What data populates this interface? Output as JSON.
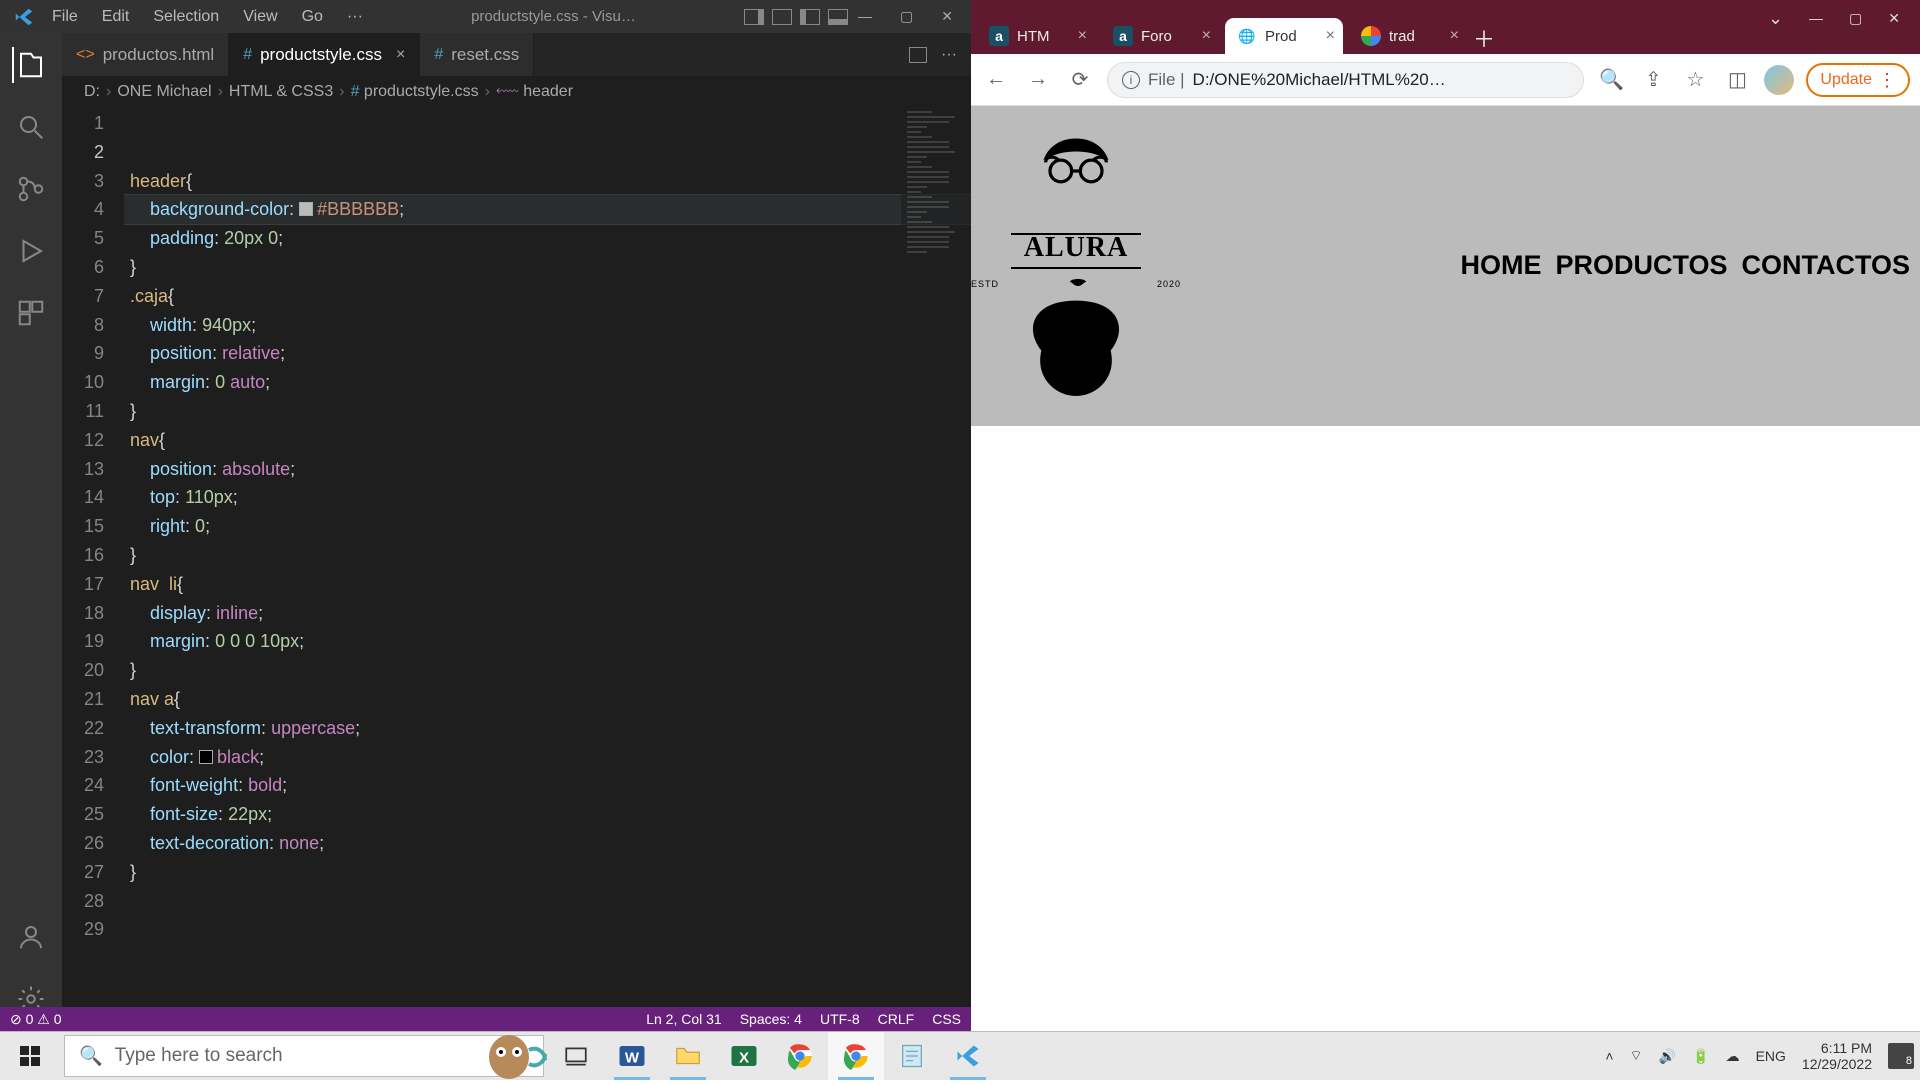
{
  "vscode": {
    "menu": [
      "File",
      "Edit",
      "Selection",
      "View",
      "Go",
      "···"
    ],
    "title": "productstyle.css - Visu…",
    "tabs": [
      {
        "icon": "<>",
        "name": "productos.html",
        "color": "#e37933",
        "active": false,
        "close": false
      },
      {
        "icon": "#",
        "name": "productstyle.css",
        "color": "#519aba",
        "active": true,
        "close": true
      },
      {
        "icon": "#",
        "name": "reset.css",
        "color": "#519aba",
        "active": false,
        "close": false
      }
    ],
    "breadcrumb": [
      "D:",
      "ONE Michael",
      "HTML & CSS3",
      "productstyle.css",
      "header"
    ],
    "statusbar": {
      "left": [
        "⊘ 0",
        "⚠ 0"
      ],
      "right": [
        "Ln 2, Col 31",
        "Spaces: 4",
        "UTF-8",
        "CRLF",
        "CSS"
      ]
    },
    "code": [
      [
        [
          "sel",
          "header"
        ],
        [
          "punc",
          "{"
        ]
      ],
      [
        [
          "sp",
          "    "
        ],
        [
          "prop",
          "background-color"
        ],
        [
          "punc",
          ": "
        ],
        [
          "swatch",
          "#BBBBBB"
        ],
        [
          "hex",
          "#BBBBBB"
        ],
        [
          "punc",
          ";"
        ]
      ],
      [
        [
          "sp",
          "    "
        ],
        [
          "prop",
          "padding"
        ],
        [
          "punc",
          ": "
        ],
        [
          "val",
          "20px 0"
        ],
        [
          "punc",
          ";"
        ]
      ],
      [
        [
          "punc",
          "}"
        ]
      ],
      [],
      [
        [
          "sel",
          ".caja"
        ],
        [
          "punc",
          "{"
        ]
      ],
      [
        [
          "sp",
          "    "
        ],
        [
          "prop",
          "width"
        ],
        [
          "punc",
          ": "
        ],
        [
          "val",
          "940px"
        ],
        [
          "punc",
          ";"
        ]
      ],
      [
        [
          "sp",
          "    "
        ],
        [
          "prop",
          "position"
        ],
        [
          "punc",
          ": "
        ],
        [
          "kw",
          "relative"
        ],
        [
          "punc",
          ";"
        ]
      ],
      [
        [
          "sp",
          "    "
        ],
        [
          "prop",
          "margin"
        ],
        [
          "punc",
          ": "
        ],
        [
          "val",
          "0 "
        ],
        [
          "kw",
          "auto"
        ],
        [
          "punc",
          ";"
        ]
      ],
      [
        [
          "punc",
          "}"
        ]
      ],
      [],
      [
        [
          "sel",
          "nav"
        ],
        [
          "punc",
          "{"
        ]
      ],
      [
        [
          "sp",
          "    "
        ],
        [
          "prop",
          "position"
        ],
        [
          "punc",
          ": "
        ],
        [
          "kw",
          "absolute"
        ],
        [
          "punc",
          ";"
        ]
      ],
      [
        [
          "sp",
          "    "
        ],
        [
          "prop",
          "top"
        ],
        [
          "punc",
          ": "
        ],
        [
          "val",
          "110px"
        ],
        [
          "punc",
          ";"
        ]
      ],
      [
        [
          "sp",
          "    "
        ],
        [
          "prop",
          "right"
        ],
        [
          "punc",
          ": "
        ],
        [
          "val",
          "0"
        ],
        [
          "punc",
          ";"
        ]
      ],
      [
        [
          "punc",
          "}"
        ]
      ],
      [],
      [
        [
          "sel",
          "nav  li"
        ],
        [
          "punc",
          "{"
        ]
      ],
      [
        [
          "sp",
          "    "
        ],
        [
          "prop",
          "display"
        ],
        [
          "punc",
          ": "
        ],
        [
          "kw",
          "inline"
        ],
        [
          "punc",
          ";"
        ]
      ],
      [
        [
          "sp",
          "    "
        ],
        [
          "prop",
          "margin"
        ],
        [
          "punc",
          ": "
        ],
        [
          "val",
          "0 0 0 10px"
        ],
        [
          "punc",
          ";"
        ]
      ],
      [
        [
          "punc",
          "}"
        ]
      ],
      [],
      [
        [
          "sel",
          "nav a"
        ],
        [
          "punc",
          "{"
        ]
      ],
      [
        [
          "sp",
          "    "
        ],
        [
          "prop",
          "text-transform"
        ],
        [
          "punc",
          ": "
        ],
        [
          "kw",
          "uppercase"
        ],
        [
          "punc",
          ";"
        ]
      ],
      [
        [
          "sp",
          "    "
        ],
        [
          "prop",
          "color"
        ],
        [
          "punc",
          ": "
        ],
        [
          "swatch",
          "black"
        ],
        [
          "kw",
          "black"
        ],
        [
          "punc",
          ";"
        ]
      ],
      [
        [
          "sp",
          "    "
        ],
        [
          "prop",
          "font-weight"
        ],
        [
          "punc",
          ": "
        ],
        [
          "kw",
          "bold"
        ],
        [
          "punc",
          ";"
        ]
      ],
      [
        [
          "sp",
          "    "
        ],
        [
          "prop",
          "font-size"
        ],
        [
          "punc",
          ": "
        ],
        [
          "val",
          "22px"
        ],
        [
          "punc",
          ";"
        ]
      ],
      [
        [
          "sp",
          "    "
        ],
        [
          "prop",
          "text-decoration"
        ],
        [
          "punc",
          ": "
        ],
        [
          "kw",
          "none"
        ],
        [
          "punc",
          ";"
        ]
      ],
      [
        [
          "punc",
          "}"
        ]
      ]
    ],
    "currentLine": 2
  },
  "chrome": {
    "tabs": [
      {
        "fav": "a",
        "name": "HTM",
        "active": false
      },
      {
        "fav": "a",
        "name": "Foro",
        "active": false
      },
      {
        "fav": "globe",
        "name": "Prod",
        "active": true
      },
      {
        "fav": "g",
        "name": "trad",
        "active": false
      }
    ],
    "url_prefix": "File |",
    "url": "D:/ONE%20Michael/HTML%20…",
    "update": "Update",
    "page": {
      "brand": "ALURA",
      "sub_left": "ESTD",
      "sub_right": "2020",
      "nav": [
        "HOME",
        "PRODUCTOS",
        "CONTACTOS"
      ]
    }
  },
  "taskbar": {
    "search_placeholder": "Type here to search",
    "lang": "ENG",
    "time": "6:11 PM",
    "date": "12/29/2022",
    "notif": "8"
  }
}
